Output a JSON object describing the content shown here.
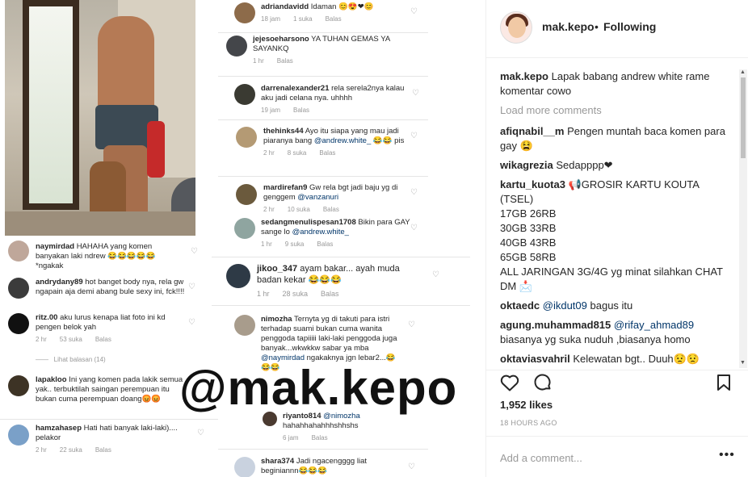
{
  "header": {
    "username": "mak.kepo",
    "separator": "•",
    "follow_label": "Following"
  },
  "watermark": "@mak.kepo",
  "caption": {
    "user": "mak.kepo",
    "text": "Lapak babang andrew white rame komentar cowo"
  },
  "load_more": "Load more comments",
  "comments": [
    {
      "user": "afiqnabil__m",
      "text": "Pengen muntah baca komen para gay 😫"
    },
    {
      "user": "wikagrezia",
      "text": "Sedapppp❤"
    },
    {
      "user": "kartu_kuota3",
      "lines": [
        "📢GROSIR KARTU KOUTA (TSEL)",
        "17GB 26RB",
        "30GB 33RB",
        "40GB 43RB",
        "65GB 58RB",
        "ALL JARINGAN 3G/4G yg minat silahkan CHAT DM 📩"
      ]
    },
    {
      "user": "oktaedc",
      "mention": "@ikdut09",
      "text": "bagus itu"
    },
    {
      "user": "agung.muhammad815",
      "mention": "@rifay_ahmad89",
      "text": "biasanya yg suka nuduh ,biasanya homo"
    },
    {
      "user": "oktaviasvahril",
      "text": "Kelewatan bgt.. Duuh😟😟"
    }
  ],
  "likes": "1,952 likes",
  "timestamp": "18 HOURS AGO",
  "add_comment_placeholder": "Add a comment...",
  "more_label": "•••",
  "icons": {
    "like": "heart-icon",
    "comment": "comment-bubble-icon",
    "save": "bookmark-icon"
  },
  "image_comments_left": [
    {
      "user": "naymirdad",
      "text": "HAHAHA yang komen banyakan laki ndrew 😂😂😂😂😂 *ngakak"
    },
    {
      "user": "andrydany89",
      "text": "hot banget body nya, rela gw ngapain aja demi abang bule sexy ini, fck!!!!"
    },
    {
      "user": "ritz.00",
      "text": "aku lurus kenapa liat foto ini kd pengen belok yah",
      "time": "2 hr",
      "likes": "53 suka",
      "reply": "Balas"
    },
    {
      "view_replies": "Lihat balasan (14)"
    },
    {
      "user": "lapakloo",
      "text": "Ini yang komen pada lakik semua yak.. terbuktilah saingan perempuan itu bukan cuma perempuan doang😡😡"
    },
    {
      "user": "hamzahasep",
      "text": "Hati hati banyak laki-laki).... pelakor",
      "time": "2 hr",
      "likes": "22 suka",
      "reply": "Balas"
    }
  ],
  "image_comments_mid": [
    {
      "user": "adriandavidd",
      "text": "Idaman 😊😍❤😊",
      "time": "18 jam",
      "likes": "1 suka",
      "reply": "Balas"
    },
    {
      "user": "jejesoeharsono",
      "text": "YA TUHAN GEMAS YA SAYANKQ",
      "time": "1 hr",
      "reply": "Balas"
    },
    {
      "user": "darrenalexander21",
      "text": "rela serela2nya kalau aku jadi celana nya. uhhhh",
      "time": "19 jam",
      "reply": "Balas"
    },
    {
      "user": "thehinks44",
      "text": "Ayo itu siapa yang mau jadi piaranya bang",
      "mention": "@andrew.white_",
      "tail": "😂😂 pis",
      "time": "2 hr",
      "likes": "8 suka",
      "reply": "Balas"
    },
    {
      "user": "mardirefan9",
      "text": "Gw rela bgt jadi baju yg di genggem",
      "mention": "@vanzanuri",
      "time": "2 hr",
      "likes": "10 suka",
      "reply": "Balas"
    },
    {
      "user": "sedangmenulispesan1708",
      "text": "Bikin para GAY sange lo",
      "mention": "@andrew.white_",
      "time": "1 hr",
      "likes": "9 suka",
      "reply": "Balas"
    },
    {
      "user": "jikoo_347",
      "text": "ayam bakar... ayah muda badan kekar 😂😂😂",
      "time": "1 hr",
      "likes": "28 suka",
      "reply": "Balas"
    },
    {
      "user": "nimozha",
      "text": "Ternyta yg di takuti para istri terhadap suami bukan cuma wanita penggoda tapiiiii laki-laki penggoda juga banyak...wkwkkw sabar ya mba",
      "mention": "@naymirdad",
      "tail": "ngakaknya jgn lebar2...😂 😂😂"
    },
    {
      "user": "riyanto814",
      "mention": "@nimozha",
      "text": "hahahhahahhhshhshs",
      "time": "6 jam",
      "reply": "Balas"
    },
    {
      "user": "shara374",
      "text": "Jadi ngacengggg liat beginiannn😂😂😂"
    }
  ]
}
